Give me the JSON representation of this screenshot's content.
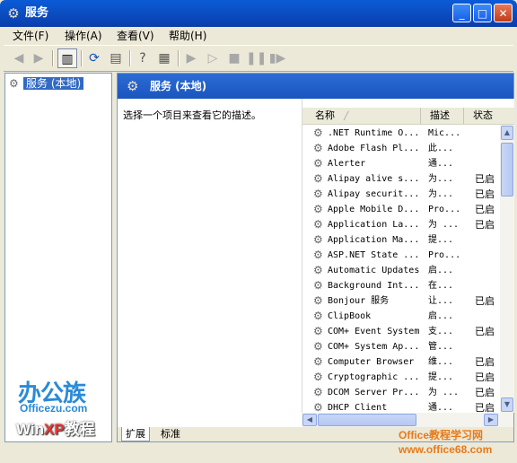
{
  "window": {
    "title": "服务",
    "buttons": {
      "minimize": "_",
      "maximize": "□",
      "close": "✕"
    }
  },
  "menu": [
    "文件(F)",
    "操作(A)",
    "查看(V)",
    "帮助(H)"
  ],
  "toolbar": [
    "back-arrow",
    "forward-arrow",
    "show-hide-tree",
    "refresh",
    "export-list",
    "help",
    "properties",
    "start",
    "start-disabled",
    "stop",
    "pause",
    "restart"
  ],
  "tree": {
    "root": "服务 (本地)"
  },
  "content": {
    "header_title": "服务 (本地)",
    "description": "选择一个项目来查看它的描述。",
    "columns": [
      "名称",
      "描述",
      "状态"
    ],
    "services": [
      {
        "name": ".NET Runtime O...",
        "desc": "Mic...",
        "status": ""
      },
      {
        "name": "Adobe Flash Pl...",
        "desc": "此...",
        "status": ""
      },
      {
        "name": "Alerter",
        "desc": "通...",
        "status": ""
      },
      {
        "name": "Alipay alive s...",
        "desc": "为...",
        "status": "已启"
      },
      {
        "name": "Alipay securit...",
        "desc": "为...",
        "status": "已启"
      },
      {
        "name": "Apple Mobile D...",
        "desc": "Pro...",
        "status": "已启"
      },
      {
        "name": "Application La...",
        "desc": "为 ...",
        "status": "已启"
      },
      {
        "name": "Application Ma...",
        "desc": "提...",
        "status": ""
      },
      {
        "name": "ASP.NET State ...",
        "desc": "Pro...",
        "status": ""
      },
      {
        "name": "Automatic Updates",
        "desc": "启...",
        "status": ""
      },
      {
        "name": "Background Int...",
        "desc": "在...",
        "status": ""
      },
      {
        "name": "Bonjour 服务",
        "desc": "让...",
        "status": "已启"
      },
      {
        "name": "ClipBook",
        "desc": "启...",
        "status": ""
      },
      {
        "name": "COM+ Event System",
        "desc": "支...",
        "status": "已启"
      },
      {
        "name": "COM+ System Ap...",
        "desc": "管...",
        "status": ""
      },
      {
        "name": "Computer Browser",
        "desc": "维...",
        "status": "已启"
      },
      {
        "name": "Cryptographic ...",
        "desc": "提...",
        "status": "已启"
      },
      {
        "name": "DCOM Server Pr...",
        "desc": "为 ...",
        "status": "已启"
      },
      {
        "name": "DHCP Client",
        "desc": "通...",
        "status": "已启"
      }
    ],
    "tabs": [
      "扩展",
      "标准"
    ]
  },
  "watermarks": {
    "logo_cn": "办公族",
    "site1": "Officezu.com",
    "winxp_prefix": "Win",
    "winxp_xp": "XP",
    "winxp_suffix": "教程",
    "site2_title": "Office教程学习网",
    "site2_url": "www.office68.com"
  }
}
